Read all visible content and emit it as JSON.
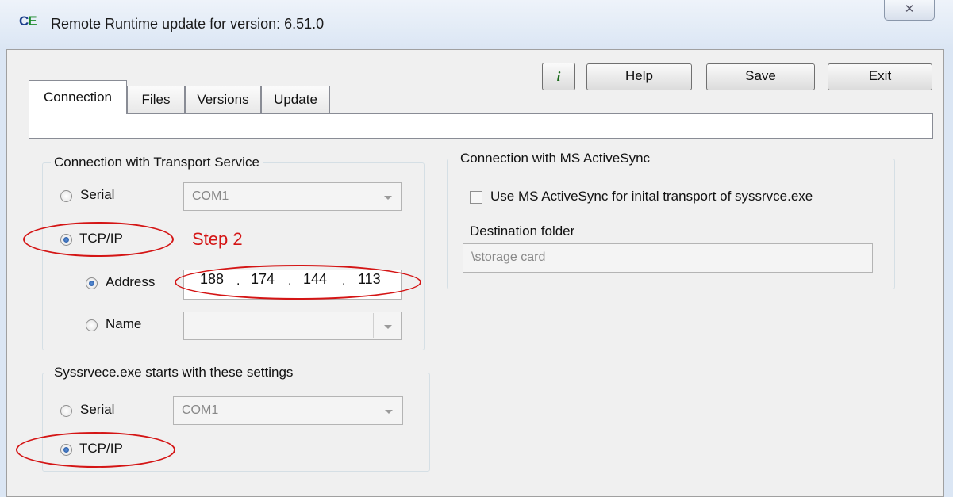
{
  "window": {
    "title": "Remote Runtime update for version: 6.51.0",
    "app_icon": "CE",
    "close_label": "✕"
  },
  "toolbar": {
    "info_label": "i",
    "help_label": "Help",
    "save_label": "Save",
    "exit_label": "Exit"
  },
  "tabs": [
    {
      "label": "Connection",
      "selected": true
    },
    {
      "label": "Files",
      "selected": false
    },
    {
      "label": "Versions",
      "selected": false
    },
    {
      "label": "Update",
      "selected": false
    }
  ],
  "transport_group": {
    "title": "Connection with Transport Service",
    "serial_label": "Serial",
    "serial_value": "COM1",
    "tcpip_label": "TCP/IP",
    "address_label": "Address",
    "ip_octets": [
      "188",
      "174",
      "144",
      "113"
    ],
    "name_label": "Name",
    "name_value": ""
  },
  "sysservice_group": {
    "title": "Syssrvece.exe starts with these settings",
    "serial_label": "Serial",
    "serial_value": "COM1",
    "tcpip_label": "TCP/IP"
  },
  "activesync_group": {
    "title": "Connection with MS ActiveSync",
    "checkbox_label": "Use MS ActiveSync for inital transport of syssrvce.exe",
    "checked": false,
    "destination_label": "Destination folder",
    "destination_value": "\\storage card"
  },
  "annotation": {
    "step_label": "Step 2",
    "color": "#d41515"
  }
}
